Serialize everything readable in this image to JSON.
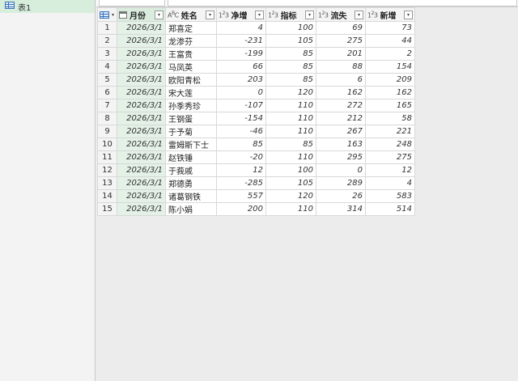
{
  "queries_pane": {
    "items": [
      {
        "label": "表1"
      }
    ]
  },
  "table": {
    "columns": [
      {
        "key": "month",
        "label": "月份",
        "type_icon": "calendar-icon",
        "type_text": ""
      },
      {
        "key": "name",
        "label": "姓名",
        "type_icon": "text-type-icon",
        "type_text": "ABC"
      },
      {
        "key": "net",
        "label": "净增",
        "type_icon": "number-type-icon",
        "type_text": "123"
      },
      {
        "key": "target",
        "label": "指标",
        "type_icon": "number-type-icon",
        "type_text": "123"
      },
      {
        "key": "loss",
        "label": "流失",
        "type_icon": "number-type-icon",
        "type_text": "123"
      },
      {
        "key": "new",
        "label": "新增",
        "type_icon": "number-type-icon",
        "type_text": "123"
      }
    ],
    "rows": [
      {
        "n": "1",
        "month": "2026/3/1",
        "name": "郑喜定",
        "net": "4",
        "target": "100",
        "loss": "69",
        "new": "73"
      },
      {
        "n": "2",
        "month": "2026/3/1",
        "name": "龙渗芬",
        "net": "-231",
        "target": "105",
        "loss": "275",
        "new": "44"
      },
      {
        "n": "3",
        "month": "2026/3/1",
        "name": "王富贵",
        "net": "-199",
        "target": "85",
        "loss": "201",
        "new": "2"
      },
      {
        "n": "4",
        "month": "2026/3/1",
        "name": "马凤英",
        "net": "66",
        "target": "85",
        "loss": "88",
        "new": "154"
      },
      {
        "n": "5",
        "month": "2026/3/1",
        "name": "欧阳青松",
        "net": "203",
        "target": "85",
        "loss": "6",
        "new": "209"
      },
      {
        "n": "6",
        "month": "2026/3/1",
        "name": "宋大莲",
        "net": "0",
        "target": "120",
        "loss": "162",
        "new": "162"
      },
      {
        "n": "7",
        "month": "2026/3/1",
        "name": "孙季秀珍",
        "net": "-107",
        "target": "110",
        "loss": "272",
        "new": "165"
      },
      {
        "n": "8",
        "month": "2026/3/1",
        "name": "王钢蛋",
        "net": "-154",
        "target": "110",
        "loss": "212",
        "new": "58"
      },
      {
        "n": "9",
        "month": "2026/3/1",
        "name": "于予菊",
        "net": "-46",
        "target": "110",
        "loss": "267",
        "new": "221"
      },
      {
        "n": "10",
        "month": "2026/3/1",
        "name": "雷姆斯下士",
        "net": "85",
        "target": "85",
        "loss": "163",
        "new": "248"
      },
      {
        "n": "11",
        "month": "2026/3/1",
        "name": "赵铁锤",
        "net": "-20",
        "target": "110",
        "loss": "295",
        "new": "275"
      },
      {
        "n": "12",
        "month": "2026/3/1",
        "name": "于莪戚",
        "net": "12",
        "target": "100",
        "loss": "0",
        "new": "12"
      },
      {
        "n": "13",
        "month": "2026/3/1",
        "name": "郑德勇",
        "net": "-285",
        "target": "105",
        "loss": "289",
        "new": "4"
      },
      {
        "n": "14",
        "month": "2026/3/1",
        "name": "诸葛钢铁",
        "net": "557",
        "target": "120",
        "loss": "26",
        "new": "583"
      },
      {
        "n": "15",
        "month": "2026/3/1",
        "name": "陈小娟",
        "net": "200",
        "target": "110",
        "loss": "314",
        "new": "514"
      }
    ]
  },
  "colors": {
    "selected_query_bg": "#d7eedd",
    "date_column_bg": "#e3f1e6",
    "header_bg": "#f4f4f4",
    "table_icon": "#3a73b8"
  }
}
